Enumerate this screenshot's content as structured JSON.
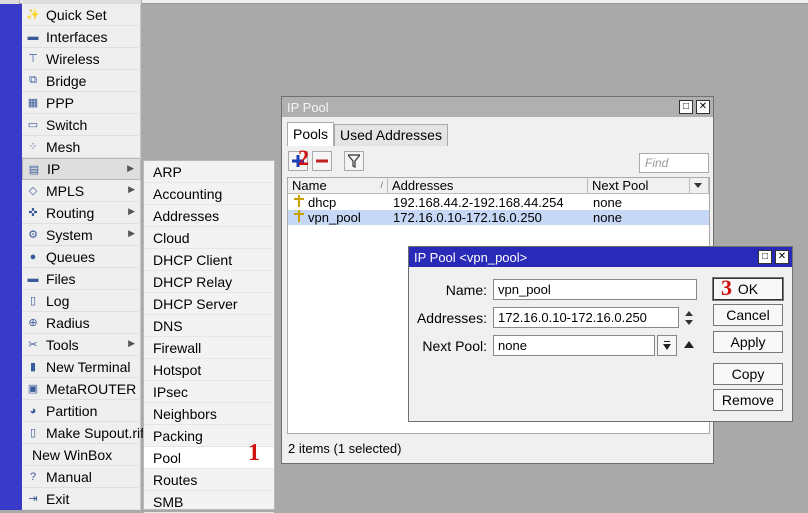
{
  "side_menu": {
    "items": [
      {
        "label": "Quick Set",
        "icon": "wand-icon"
      },
      {
        "label": "Interfaces",
        "icon": "interfaces-icon"
      },
      {
        "label": "Wireless",
        "icon": "antenna-icon"
      },
      {
        "label": "Bridge",
        "icon": "bridge-icon"
      },
      {
        "label": "PPP",
        "icon": "ppp-icon"
      },
      {
        "label": "Switch",
        "icon": "switch-icon"
      },
      {
        "label": "Mesh",
        "icon": "mesh-icon"
      },
      {
        "label": "IP",
        "icon": "ip-icon",
        "submenu": true
      },
      {
        "label": "MPLS",
        "icon": "mpls-icon",
        "submenu": true
      },
      {
        "label": "Routing",
        "icon": "routing-icon",
        "submenu": true
      },
      {
        "label": "System",
        "icon": "gear-icon",
        "submenu": true
      },
      {
        "label": "Queues",
        "icon": "queues-icon"
      },
      {
        "label": "Files",
        "icon": "folder-icon"
      },
      {
        "label": "Log",
        "icon": "log-icon"
      },
      {
        "label": "Radius",
        "icon": "radius-icon"
      },
      {
        "label": "Tools",
        "icon": "tools-icon",
        "submenu": true
      },
      {
        "label": "New Terminal",
        "icon": "terminal-icon"
      },
      {
        "label": "MetaROUTER",
        "icon": "metarouter-icon"
      },
      {
        "label": "Partition",
        "icon": "partition-icon"
      },
      {
        "label": "Make Supout.rif",
        "icon": "document-icon"
      },
      {
        "label": "New WinBox",
        "icon": ""
      },
      {
        "label": "Manual",
        "icon": "help-icon"
      },
      {
        "label": "Exit",
        "icon": "exit-icon"
      }
    ],
    "arrow": "▶"
  },
  "ip_submenu": {
    "items": [
      "ARP",
      "Accounting",
      "Addresses",
      "Cloud",
      "DHCP Client",
      "DHCP Relay",
      "DHCP Server",
      "DNS",
      "Firewall",
      "Hotspot",
      "IPsec",
      "Neighbors",
      "Packing",
      "Pool",
      "Routes",
      "SMB"
    ],
    "selected": "Pool"
  },
  "step_marks": {
    "one": "1",
    "two": "2",
    "three": "3"
  },
  "pool_window": {
    "title": "IP Pool",
    "tabs": [
      "Pools",
      "Used Addresses"
    ],
    "find_placeholder": "Find",
    "columns": [
      "Name",
      "Addresses",
      "Next Pool"
    ],
    "rows": [
      {
        "name": "dhcp",
        "addresses": "192.168.44.2-192.168.44.254",
        "next_pool": "none"
      },
      {
        "name": "vpn_pool",
        "addresses": "172.16.0.10-172.16.0.250",
        "next_pool": "none"
      }
    ],
    "status": "2 items (1 selected)"
  },
  "detail_window": {
    "title": "IP Pool <vpn_pool>",
    "fields": {
      "name_label": "Name:",
      "name_value": "vpn_pool",
      "addresses_label": "Addresses:",
      "addresses_value": "172.16.0.10-172.16.0.250",
      "next_pool_label": "Next Pool:",
      "next_pool_value": "none"
    },
    "buttons": {
      "ok": "OK",
      "cancel": "Cancel",
      "apply": "Apply",
      "copy": "Copy",
      "remove": "Remove"
    }
  },
  "colors": {
    "accent_strip": "#3a3ac8",
    "active_title": "#2a2ab8",
    "selected_row": "#c6d8f5",
    "step_mark": "#d01010"
  }
}
